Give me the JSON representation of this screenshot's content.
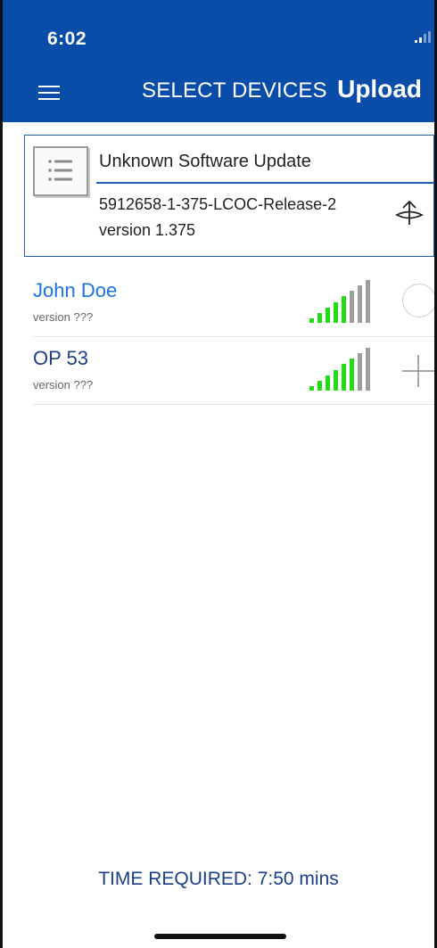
{
  "status_bar": {
    "time": "6:02"
  },
  "header": {
    "title": "SELECT DEVICES",
    "upload_label": "Upload"
  },
  "update": {
    "title": "Unknown Software Update",
    "file": "5912658-1-375-LCOC-Release-2",
    "version": "version 1.375"
  },
  "devices": [
    {
      "name": "John Doe",
      "version": "version ???",
      "name_color": "#1a73e8",
      "signal_bars_green": 5,
      "signal_bars_total": 8,
      "action": "select-circle"
    },
    {
      "name": "OP 53",
      "version": "version ???",
      "name_color": "#1e3f87",
      "signal_bars_green": 6,
      "signal_bars_total": 8,
      "action": "add"
    }
  ],
  "footer": {
    "time_required": "TIME REQUIRED: 7:50 mins"
  },
  "colors": {
    "header_bg": "#0a4da8",
    "card_border": "#1f5fb5",
    "signal_green": "#22dd11",
    "signal_gray": "#9e9e9e",
    "footer_text": "#1a3f8a"
  },
  "icons": {
    "menu": "hamburger-menu-icon",
    "update": "list-document-icon",
    "upload": "upload-arrow-icon",
    "select": "empty-circle-icon",
    "add": "plus-icon"
  }
}
